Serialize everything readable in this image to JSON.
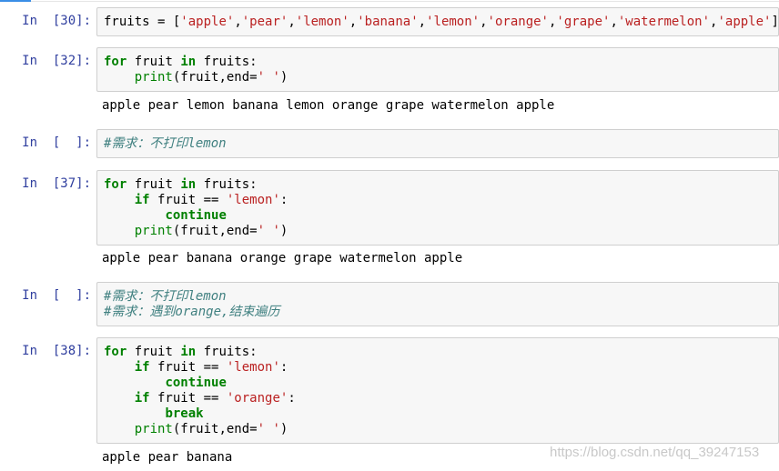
{
  "cells": [
    {
      "prompt": "In  [30]:",
      "lines": [
        [
          [
            "fruits = [",
            ""
          ],
          [
            "'apple'",
            "str"
          ],
          [
            ",",
            ""
          ],
          [
            "'pear'",
            "str"
          ],
          [
            ",",
            ""
          ],
          [
            "'lemon'",
            "str"
          ],
          [
            ",",
            ""
          ],
          [
            "'banana'",
            "str"
          ],
          [
            ",",
            ""
          ],
          [
            "'lemon'",
            "str"
          ],
          [
            ",",
            ""
          ],
          [
            "'orange'",
            "str"
          ],
          [
            ",",
            ""
          ],
          [
            "'grape'",
            "str"
          ],
          [
            ",",
            ""
          ],
          [
            "'watermelon'",
            "str"
          ],
          [
            ",",
            ""
          ],
          [
            "'apple'",
            "str"
          ],
          [
            "]",
            ""
          ]
        ]
      ]
    },
    {
      "prompt": "In  [32]:",
      "lines": [
        [
          [
            "for",
            "kw"
          ],
          [
            " fruit ",
            ""
          ],
          [
            "in",
            "kw"
          ],
          [
            " fruits:",
            ""
          ]
        ],
        [
          [
            "    ",
            ""
          ],
          [
            "print",
            "bi"
          ],
          [
            "(fruit,end=",
            ""
          ],
          [
            "' '",
            "str"
          ],
          [
            ")",
            ""
          ]
        ]
      ],
      "output": "apple pear lemon banana lemon orange grape watermelon apple"
    },
    {
      "prompt": "In  [  ]:",
      "lines": [
        [
          [
            "#需求：不打印lemon",
            "cm"
          ]
        ]
      ]
    },
    {
      "prompt": "In  [37]:",
      "lines": [
        [
          [
            "for",
            "kw"
          ],
          [
            " fruit ",
            ""
          ],
          [
            "in",
            "kw"
          ],
          [
            " fruits:",
            ""
          ]
        ],
        [
          [
            "    ",
            ""
          ],
          [
            "if",
            "kw"
          ],
          [
            " fruit == ",
            ""
          ],
          [
            "'lemon'",
            "str"
          ],
          [
            ":",
            ""
          ]
        ],
        [
          [
            "        ",
            ""
          ],
          [
            "continue",
            "kw"
          ]
        ],
        [
          [
            "    ",
            ""
          ],
          [
            "print",
            "bi"
          ],
          [
            "(fruit,end=",
            ""
          ],
          [
            "' '",
            "str"
          ],
          [
            ")",
            ""
          ]
        ]
      ],
      "output": "apple pear banana orange grape watermelon apple"
    },
    {
      "prompt": "In  [  ]:",
      "lines": [
        [
          [
            "#需求：不打印lemon",
            "cm"
          ]
        ],
        [
          [
            "#需求：遇到orange,结束遍历",
            "cm"
          ]
        ]
      ]
    },
    {
      "prompt": "In  [38]:",
      "lines": [
        [
          [
            "for",
            "kw"
          ],
          [
            " fruit ",
            ""
          ],
          [
            "in",
            "kw"
          ],
          [
            " fruits:",
            ""
          ]
        ],
        [
          [
            "    ",
            ""
          ],
          [
            "if",
            "kw"
          ],
          [
            " fruit == ",
            ""
          ],
          [
            "'lemon'",
            "str"
          ],
          [
            ":",
            ""
          ]
        ],
        [
          [
            "        ",
            ""
          ],
          [
            "continue",
            "kw"
          ]
        ],
        [
          [
            "    ",
            ""
          ],
          [
            "if",
            "kw"
          ],
          [
            " fruit == ",
            ""
          ],
          [
            "'orange'",
            "str"
          ],
          [
            ":",
            ""
          ]
        ],
        [
          [
            "        ",
            ""
          ],
          [
            "break",
            "kw"
          ]
        ],
        [
          [
            "    ",
            ""
          ],
          [
            "print",
            "bi"
          ],
          [
            "(fruit,end=",
            ""
          ],
          [
            "' '",
            "str"
          ],
          [
            ")",
            ""
          ]
        ]
      ],
      "output": "apple pear banana"
    }
  ],
  "watermark": "https://blog.csdn.net/qq_39247153",
  "colors": {
    "prompt": "#303f9f",
    "keyword": "#008000",
    "string": "#ba2121",
    "comment": "#408080",
    "cell_bg": "#f7f7f7",
    "cell_border": "#cfcfcf"
  }
}
